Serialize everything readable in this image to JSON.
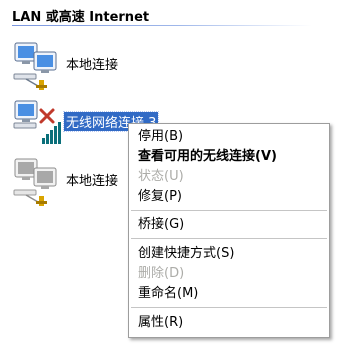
{
  "group": {
    "title": "LAN 或高速 Internet"
  },
  "connections": [
    {
      "label": "本地连接",
      "icon": "lan-connection-icon",
      "status": "enabled"
    },
    {
      "label": "无线网络连接 3",
      "icon": "wireless-connection-icon",
      "status": "disabled",
      "selected": true
    },
    {
      "label": "本地连接",
      "icon": "lan-connection-icon",
      "status": "disabled-gray"
    }
  ],
  "context_menu": {
    "items": [
      {
        "label": "停用(B)",
        "state": "normal"
      },
      {
        "label": "查看可用的无线连接(V)",
        "state": "default"
      },
      {
        "label": "状态(U)",
        "state": "disabled"
      },
      {
        "label": "修复(P)",
        "state": "normal"
      },
      {
        "label": "桥接(G)",
        "state": "normal"
      },
      {
        "label": "创建快捷方式(S)",
        "state": "normal"
      },
      {
        "label": "删除(D)",
        "state": "disabled"
      },
      {
        "label": "重命名(M)",
        "state": "normal"
      },
      {
        "label": "属性(R)",
        "state": "normal"
      }
    ]
  },
  "colors": {
    "selection": "#316ac5",
    "rule": "#7a96df",
    "disabled_text": "#acaca8",
    "wireless_x": "#c0392b",
    "connector": "#d9a400"
  }
}
